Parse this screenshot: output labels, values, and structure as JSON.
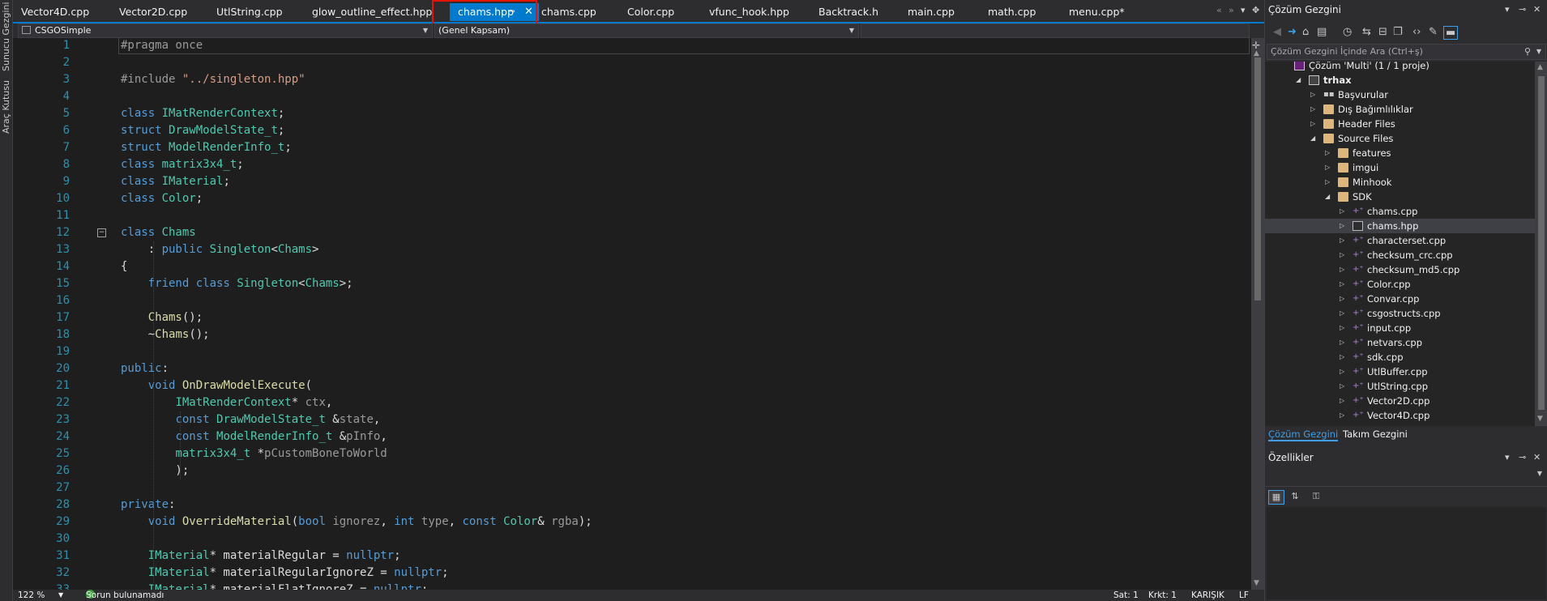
{
  "left_strip": {
    "tabs": [
      "Sunucu Gezgini",
      "Araç Kutusu"
    ]
  },
  "editor_tabs": [
    {
      "label": "Vector4D.cpp",
      "active": false
    },
    {
      "label": "Vector2D.cpp",
      "active": false
    },
    {
      "label": "UtlString.cpp",
      "active": false
    },
    {
      "label": "glow_outline_effect.hpp",
      "active": false
    },
    {
      "label": "chams.hpp",
      "active": true
    },
    {
      "label": "chams.cpp",
      "active": false
    },
    {
      "label": "Color.cpp",
      "active": false
    },
    {
      "label": "vfunc_hook.hpp",
      "active": false
    },
    {
      "label": "Backtrack.h",
      "active": false
    },
    {
      "label": "main.cpp",
      "active": false
    },
    {
      "label": "math.cpp",
      "active": false
    },
    {
      "label": "menu.cpp*",
      "active": false
    }
  ],
  "nav": {
    "project": "CSGOSimple",
    "scope": "(Genel Kapsam)"
  },
  "colors": {
    "accent": "#007acc",
    "highlight_box": "#e51400",
    "keyword": "#569cd6",
    "type": "#4ec9b0",
    "string": "#d69d85",
    "function": "#dcdcaa",
    "line_number": "#2b91af"
  },
  "code": {
    "lines": [
      {
        "n": "1",
        "t": [
          [
            "pp",
            "#pragma once"
          ]
        ]
      },
      {
        "n": "2",
        "t": []
      },
      {
        "n": "3",
        "t": [
          [
            "pp",
            "#include "
          ],
          [
            "str",
            "\"../singleton.hpp\""
          ]
        ]
      },
      {
        "n": "4",
        "t": []
      },
      {
        "n": "5",
        "t": [
          [
            "kw",
            "class "
          ],
          [
            "ty",
            "IMatRenderContext"
          ],
          [
            "id",
            ";"
          ]
        ]
      },
      {
        "n": "6",
        "t": [
          [
            "kw",
            "struct "
          ],
          [
            "ty",
            "DrawModelState_t"
          ],
          [
            "id",
            ";"
          ]
        ]
      },
      {
        "n": "7",
        "t": [
          [
            "kw",
            "struct "
          ],
          [
            "ty",
            "ModelRenderInfo_t"
          ],
          [
            "id",
            ";"
          ]
        ]
      },
      {
        "n": "8",
        "t": [
          [
            "kw",
            "class "
          ],
          [
            "ty",
            "matrix3x4_t"
          ],
          [
            "id",
            ";"
          ]
        ]
      },
      {
        "n": "9",
        "t": [
          [
            "kw",
            "class "
          ],
          [
            "ty",
            "IMaterial"
          ],
          [
            "id",
            ";"
          ]
        ]
      },
      {
        "n": "10",
        "t": [
          [
            "kw",
            "class "
          ],
          [
            "ty",
            "Color"
          ],
          [
            "id",
            ";"
          ]
        ]
      },
      {
        "n": "11",
        "t": []
      },
      {
        "n": "12",
        "t": [
          [
            "kw",
            "class "
          ],
          [
            "ty",
            "Chams"
          ]
        ]
      },
      {
        "n": "13",
        "t": [
          [
            "id",
            "    : "
          ],
          [
            "kw",
            "public "
          ],
          [
            "ty",
            "Singleton"
          ],
          [
            "id",
            "<"
          ],
          [
            "ty",
            "Chams"
          ],
          [
            "id",
            ">"
          ]
        ]
      },
      {
        "n": "14",
        "t": [
          [
            "id",
            "{"
          ]
        ]
      },
      {
        "n": "15",
        "t": [
          [
            "id",
            "    "
          ],
          [
            "kw",
            "friend class "
          ],
          [
            "ty",
            "Singleton"
          ],
          [
            "id",
            "<"
          ],
          [
            "ty",
            "Chams"
          ],
          [
            "id",
            ">;"
          ]
        ]
      },
      {
        "n": "16",
        "t": []
      },
      {
        "n": "17",
        "t": [
          [
            "id",
            "    "
          ],
          [
            "fn",
            "Chams"
          ],
          [
            "id",
            "();"
          ]
        ]
      },
      {
        "n": "18",
        "t": [
          [
            "id",
            "    ~"
          ],
          [
            "fn",
            "Chams"
          ],
          [
            "id",
            "();"
          ]
        ]
      },
      {
        "n": "19",
        "t": []
      },
      {
        "n": "20",
        "t": [
          [
            "kw",
            "public"
          ],
          [
            "id",
            ":"
          ]
        ]
      },
      {
        "n": "21",
        "t": [
          [
            "id",
            "    "
          ],
          [
            "kw",
            "void "
          ],
          [
            "fn",
            "OnDrawModelExecute"
          ],
          [
            "id",
            "("
          ]
        ]
      },
      {
        "n": "22",
        "t": [
          [
            "id",
            "        "
          ],
          [
            "ty",
            "IMatRenderContext"
          ],
          [
            "id",
            "* "
          ],
          [
            "pm",
            "ctx"
          ],
          [
            "id",
            ","
          ]
        ]
      },
      {
        "n": "23",
        "t": [
          [
            "id",
            "        "
          ],
          [
            "kw",
            "const "
          ],
          [
            "ty",
            "DrawModelState_t"
          ],
          [
            "id",
            " &"
          ],
          [
            "pm",
            "state"
          ],
          [
            "id",
            ","
          ]
        ]
      },
      {
        "n": "24",
        "t": [
          [
            "id",
            "        "
          ],
          [
            "kw",
            "const "
          ],
          [
            "ty",
            "ModelRenderInfo_t"
          ],
          [
            "id",
            " &"
          ],
          [
            "pm",
            "pInfo"
          ],
          [
            "id",
            ","
          ]
        ]
      },
      {
        "n": "25",
        "t": [
          [
            "id",
            "        "
          ],
          [
            "ty",
            "matrix3x4_t"
          ],
          [
            "id",
            " *"
          ],
          [
            "pm",
            "pCustomBoneToWorld"
          ]
        ]
      },
      {
        "n": "26",
        "t": [
          [
            "id",
            "        );"
          ]
        ]
      },
      {
        "n": "27",
        "t": []
      },
      {
        "n": "28",
        "t": [
          [
            "kw",
            "private"
          ],
          [
            "id",
            ":"
          ]
        ]
      },
      {
        "n": "29",
        "t": [
          [
            "id",
            "    "
          ],
          [
            "kw",
            "void "
          ],
          [
            "fn",
            "OverrideMaterial"
          ],
          [
            "id",
            "("
          ],
          [
            "kw",
            "bool "
          ],
          [
            "pm",
            "ignorez"
          ],
          [
            "id",
            ", "
          ],
          [
            "kw",
            "int "
          ],
          [
            "pm",
            "type"
          ],
          [
            "id",
            ", "
          ],
          [
            "kw",
            "const "
          ],
          [
            "ty",
            "Color"
          ],
          [
            "id",
            "& "
          ],
          [
            "pm",
            "rgba"
          ],
          [
            "id",
            ");"
          ]
        ]
      },
      {
        "n": "30",
        "t": []
      },
      {
        "n": "31",
        "t": [
          [
            "id",
            "    "
          ],
          [
            "ty",
            "IMaterial"
          ],
          [
            "id",
            "* materialRegular = "
          ],
          [
            "kw",
            "nullptr"
          ],
          [
            "id",
            ";"
          ]
        ]
      },
      {
        "n": "32",
        "t": [
          [
            "id",
            "    "
          ],
          [
            "ty",
            "IMaterial"
          ],
          [
            "id",
            "* materialRegularIgnoreZ = "
          ],
          [
            "kw",
            "nullptr"
          ],
          [
            "id",
            ";"
          ]
        ]
      },
      {
        "n": "33",
        "t": [
          [
            "id",
            "    "
          ],
          [
            "ty",
            "IMaterial"
          ],
          [
            "id",
            "* materialFlatIgnoreZ = "
          ],
          [
            "kw",
            "nullptr"
          ],
          [
            "id",
            ";"
          ]
        ]
      }
    ]
  },
  "status": {
    "zoom": "122 %",
    "issues": "Sorun bulunamadı",
    "line": "Sat: 1",
    "char": "Krkt: 1",
    "mode": "KARIŞIK",
    "eol": "LF"
  },
  "solution_explorer": {
    "title": "Çözüm Gezgini",
    "search_placeholder": "Çözüm Gezgini İçinde Ara (Ctrl+ş)",
    "tree": [
      {
        "label": "Çözüm 'Multi' (1 / 1 proje)",
        "depth": 0,
        "icon": "solution-icon",
        "expander": "none",
        "bold": false
      },
      {
        "label": "trhax",
        "depth": 1,
        "icon": "project-icon",
        "expander": "expanded",
        "bold": true
      },
      {
        "label": "Başvurular",
        "depth": 2,
        "icon": "references-icon",
        "expander": "collapsed",
        "bold": false
      },
      {
        "label": "Dış Bağımlılıklar",
        "depth": 2,
        "icon": "folder-icon",
        "expander": "collapsed",
        "bold": false
      },
      {
        "label": "Header Files",
        "depth": 2,
        "icon": "folder-icon",
        "expander": "collapsed",
        "bold": false
      },
      {
        "label": "Source Files",
        "depth": 2,
        "icon": "folder-icon",
        "expander": "expanded",
        "bold": false
      },
      {
        "label": "features",
        "depth": 3,
        "icon": "folder-icon",
        "expander": "collapsed",
        "bold": false
      },
      {
        "label": "imgui",
        "depth": 3,
        "icon": "folder-icon",
        "expander": "collapsed",
        "bold": false
      },
      {
        "label": "Minhook",
        "depth": 3,
        "icon": "folder-icon",
        "expander": "collapsed",
        "bold": false
      },
      {
        "label": "SDK",
        "depth": 3,
        "icon": "folder-icon",
        "expander": "expanded",
        "bold": false
      },
      {
        "label": "chams.cpp",
        "depth": 4,
        "icon": "cpp-file-icon",
        "expander": "collapsed",
        "bold": false
      },
      {
        "label": "chams.hpp",
        "depth": 4,
        "icon": "header-file-icon",
        "expander": "collapsed",
        "bold": false,
        "selected": true
      },
      {
        "label": "characterset.cpp",
        "depth": 4,
        "icon": "cpp-file-icon",
        "expander": "collapsed",
        "bold": false
      },
      {
        "label": "checksum_crc.cpp",
        "depth": 4,
        "icon": "cpp-file-icon",
        "expander": "collapsed",
        "bold": false
      },
      {
        "label": "checksum_md5.cpp",
        "depth": 4,
        "icon": "cpp-file-icon",
        "expander": "collapsed",
        "bold": false
      },
      {
        "label": "Color.cpp",
        "depth": 4,
        "icon": "cpp-file-icon",
        "expander": "collapsed",
        "bold": false
      },
      {
        "label": "Convar.cpp",
        "depth": 4,
        "icon": "cpp-file-icon",
        "expander": "collapsed",
        "bold": false
      },
      {
        "label": "csgostructs.cpp",
        "depth": 4,
        "icon": "cpp-file-icon",
        "expander": "collapsed",
        "bold": false
      },
      {
        "label": "input.cpp",
        "depth": 4,
        "icon": "cpp-file-icon",
        "expander": "collapsed",
        "bold": false
      },
      {
        "label": "netvars.cpp",
        "depth": 4,
        "icon": "cpp-file-icon",
        "expander": "collapsed",
        "bold": false
      },
      {
        "label": "sdk.cpp",
        "depth": 4,
        "icon": "cpp-file-icon",
        "expander": "collapsed",
        "bold": false
      },
      {
        "label": "UtlBuffer.cpp",
        "depth": 4,
        "icon": "cpp-file-icon",
        "expander": "collapsed",
        "bold": false
      },
      {
        "label": "UtlString.cpp",
        "depth": 4,
        "icon": "cpp-file-icon",
        "expander": "collapsed",
        "bold": false
      },
      {
        "label": "Vector2D.cpp",
        "depth": 4,
        "icon": "cpp-file-icon",
        "expander": "collapsed",
        "bold": false
      },
      {
        "label": "Vector4D.cpp",
        "depth": 4,
        "icon": "cpp-file-icon",
        "expander": "collapsed",
        "bold": false
      }
    ],
    "bottom_tabs": [
      "Çözüm Gezgini",
      "Takım Gezgini"
    ]
  },
  "properties": {
    "title": "Özellikler"
  }
}
